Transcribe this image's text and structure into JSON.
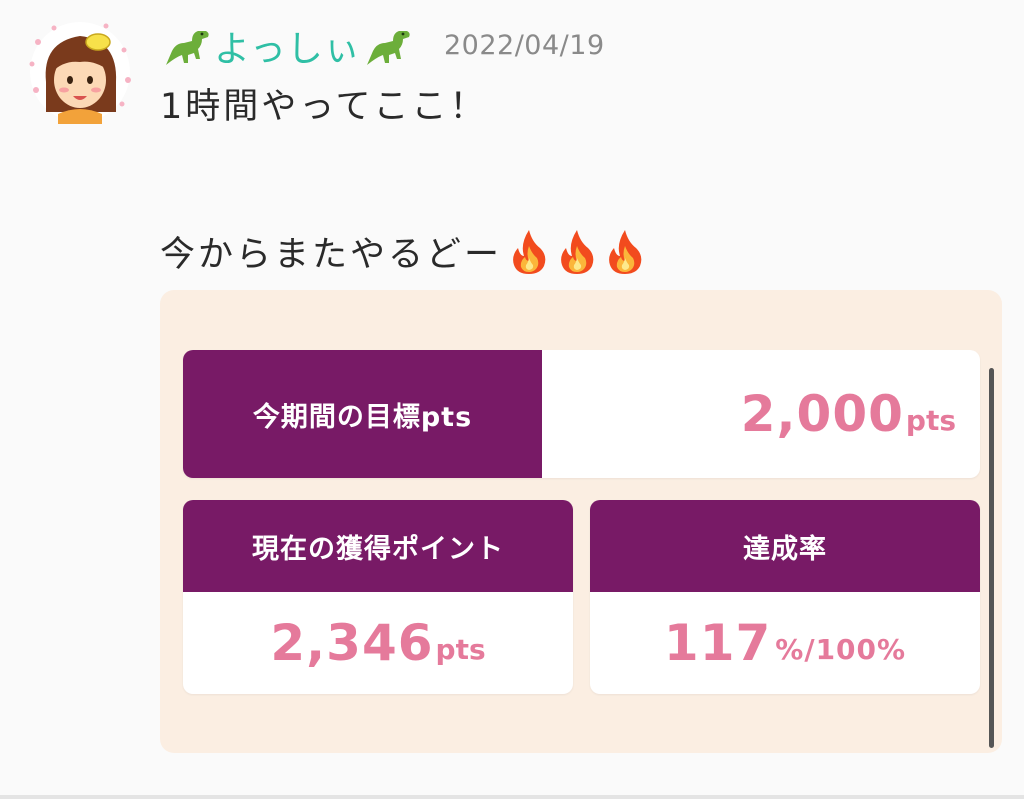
{
  "post": {
    "username": "よっしぃ",
    "username_decoration_icon": "dinosaur-icon",
    "timestamp": "2022/04/19",
    "message_line1": "1時間やってここ！",
    "message_line2": "今からまたやるどー",
    "message_emoji": "fire-icon",
    "emoji_count": 3
  },
  "card": {
    "goal_label": "今期間の目標pts",
    "goal_value": "2,000",
    "goal_unit": "pts",
    "current_label": "現在の獲得ポイント",
    "current_value": "2,346",
    "current_unit": "pts",
    "rate_label": "達成率",
    "rate_value": "117",
    "rate_unit": "%/100%"
  },
  "colors": {
    "accent_purple": "#781a66",
    "value_pink": "#e57a9b",
    "username_teal": "#2fbfa5",
    "card_background": "#fbeee2"
  }
}
